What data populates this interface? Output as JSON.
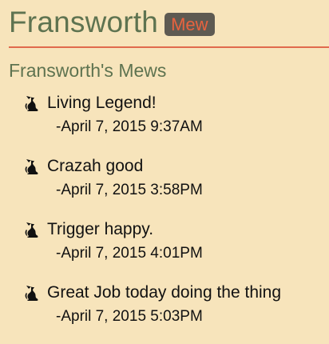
{
  "header": {
    "title": "Fransworth",
    "badge": "Mew"
  },
  "subtitle": "Fransworth's Mews",
  "mews": [
    {
      "text": "Living Legend!",
      "time": "-April 7, 2015 9:37AM",
      "icon": "cat-icon"
    },
    {
      "text": "Crazah good",
      "time": "-April 7, 2015 3:58PM",
      "icon": "cat-icon"
    },
    {
      "text": "Trigger happy.",
      "time": "-April 7, 2015 4:01PM",
      "icon": "cat-icon"
    },
    {
      "text": "Great Job today doing the thing",
      "time": "-April 7, 2015 5:03PM",
      "icon": "cat-icon"
    }
  ],
  "colors": {
    "background": "#f7e4bb",
    "heading": "#5e7350",
    "accent": "#e06a4c",
    "badge_bg": "#5e5a52",
    "badge_text": "#e8633f"
  }
}
